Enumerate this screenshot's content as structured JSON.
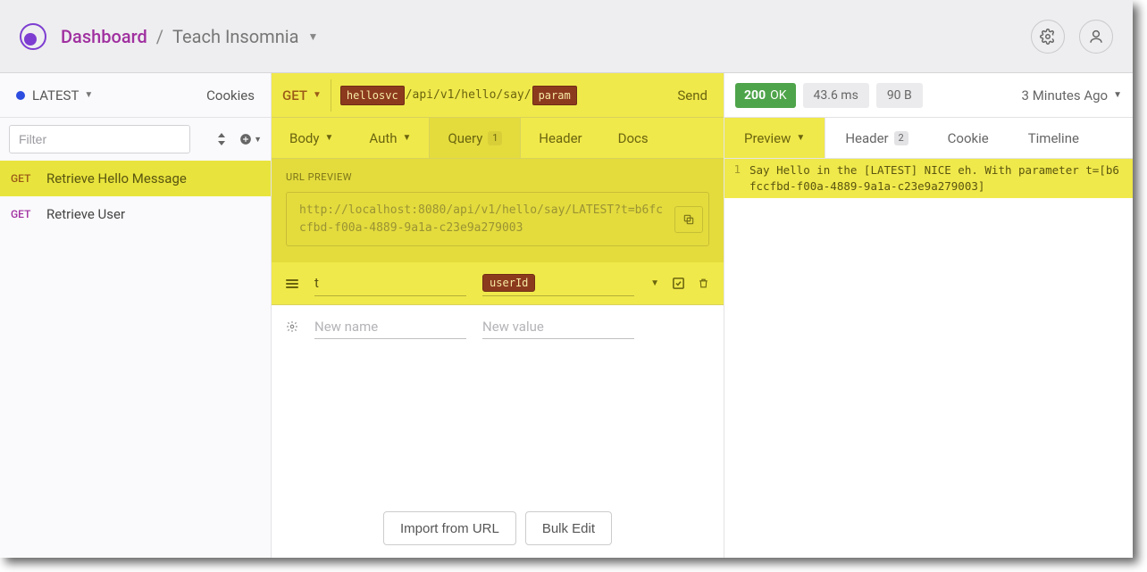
{
  "topbar": {
    "dashboard": "Dashboard",
    "separator": "/",
    "workspace": "Teach Insomnia"
  },
  "sidebar": {
    "env_name": "LATEST",
    "cookies_label": "Cookies",
    "filter_placeholder": "Filter",
    "requests": [
      {
        "method": "GET",
        "name": "Retrieve Hello Message",
        "active": true
      },
      {
        "method": "GET",
        "name": "Retrieve User",
        "active": false
      }
    ]
  },
  "request": {
    "method": "GET",
    "url_chip_1": "hellosvc",
    "url_mid": "/api/v1/hello/say/",
    "url_chip_2": "param",
    "send_label": "Send",
    "tabs": {
      "body": "Body",
      "auth": "Auth",
      "query": "Query",
      "query_badge": "1",
      "header": "Header",
      "docs": "Docs"
    },
    "url_preview_label": "URL PREVIEW",
    "url_preview_value": "http://localhost:8080/api/v1/hello/say/LATEST?t=b6fccfbd-f00a-4889-9a1a-c23e9a279003",
    "params": [
      {
        "name": "t",
        "value_chip": "userId",
        "enabled": true
      }
    ],
    "new_name_placeholder": "New name",
    "new_value_placeholder": "New value",
    "import_url_label": "Import from URL",
    "bulk_edit_label": "Bulk Edit"
  },
  "response": {
    "status_code": "200",
    "status_text": "OK",
    "time": "43.6 ms",
    "size": "90 B",
    "history": "3 Minutes Ago",
    "tabs": {
      "preview": "Preview",
      "header": "Header",
      "header_badge": "2",
      "cookie": "Cookie",
      "timeline": "Timeline"
    },
    "body_lines": [
      "Say Hello in the [LATEST] NICE eh. With parameter t=[b6fccfbd-f00a-4889-9a1a-c23e9a279003]"
    ]
  }
}
